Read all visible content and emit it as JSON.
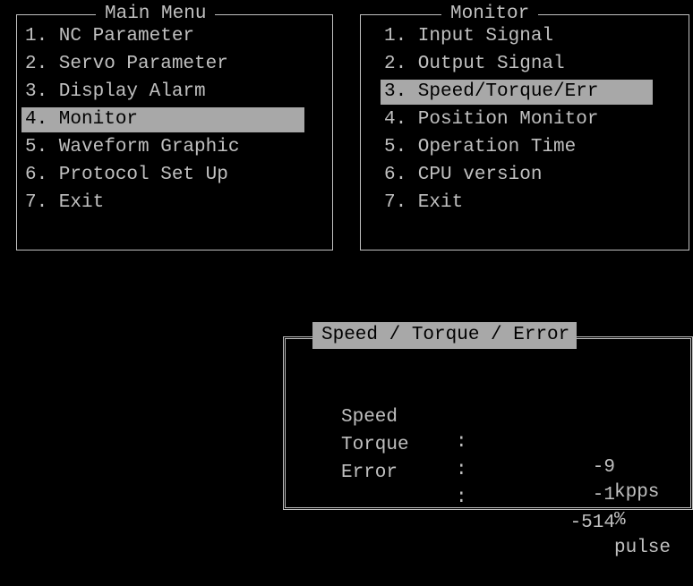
{
  "main_menu": {
    "title": "Main Menu",
    "items": [
      {
        "label": "1. NC Parameter"
      },
      {
        "label": "2. Servo Parameter"
      },
      {
        "label": "3. Display Alarm"
      },
      {
        "label": "4. Monitor",
        "selected": true
      },
      {
        "label": "5. Waveform Graphic"
      },
      {
        "label": "6. Protocol Set Up"
      },
      {
        "label": "7. Exit"
      }
    ]
  },
  "monitor_menu": {
    "title": "Monitor",
    "items": [
      {
        "label": "1. Input Signal"
      },
      {
        "label": "2. Output Signal"
      },
      {
        "label": "3. Speed/Torque/Err",
        "selected": true
      },
      {
        "label": "4. Position Monitor"
      },
      {
        "label": "5. Operation Time"
      },
      {
        "label": "6. CPU version"
      },
      {
        "label": "7. Exit"
      }
    ]
  },
  "ste_panel": {
    "title": "Speed / Torque / Error",
    "rows": [
      {
        "label": "Speed",
        "colon": ":",
        "value": "-9",
        "unit": "kpps"
      },
      {
        "label": "Torque",
        "colon": ":",
        "value": "-1",
        "unit": "%"
      },
      {
        "label": "Error",
        "colon": ":",
        "value": "-514",
        "unit": "pulse"
      }
    ]
  },
  "colors": {
    "background": "#000000",
    "text": "#c0c0c0",
    "highlight_bg": "#a8a8a8",
    "highlight_text": "#000000"
  }
}
